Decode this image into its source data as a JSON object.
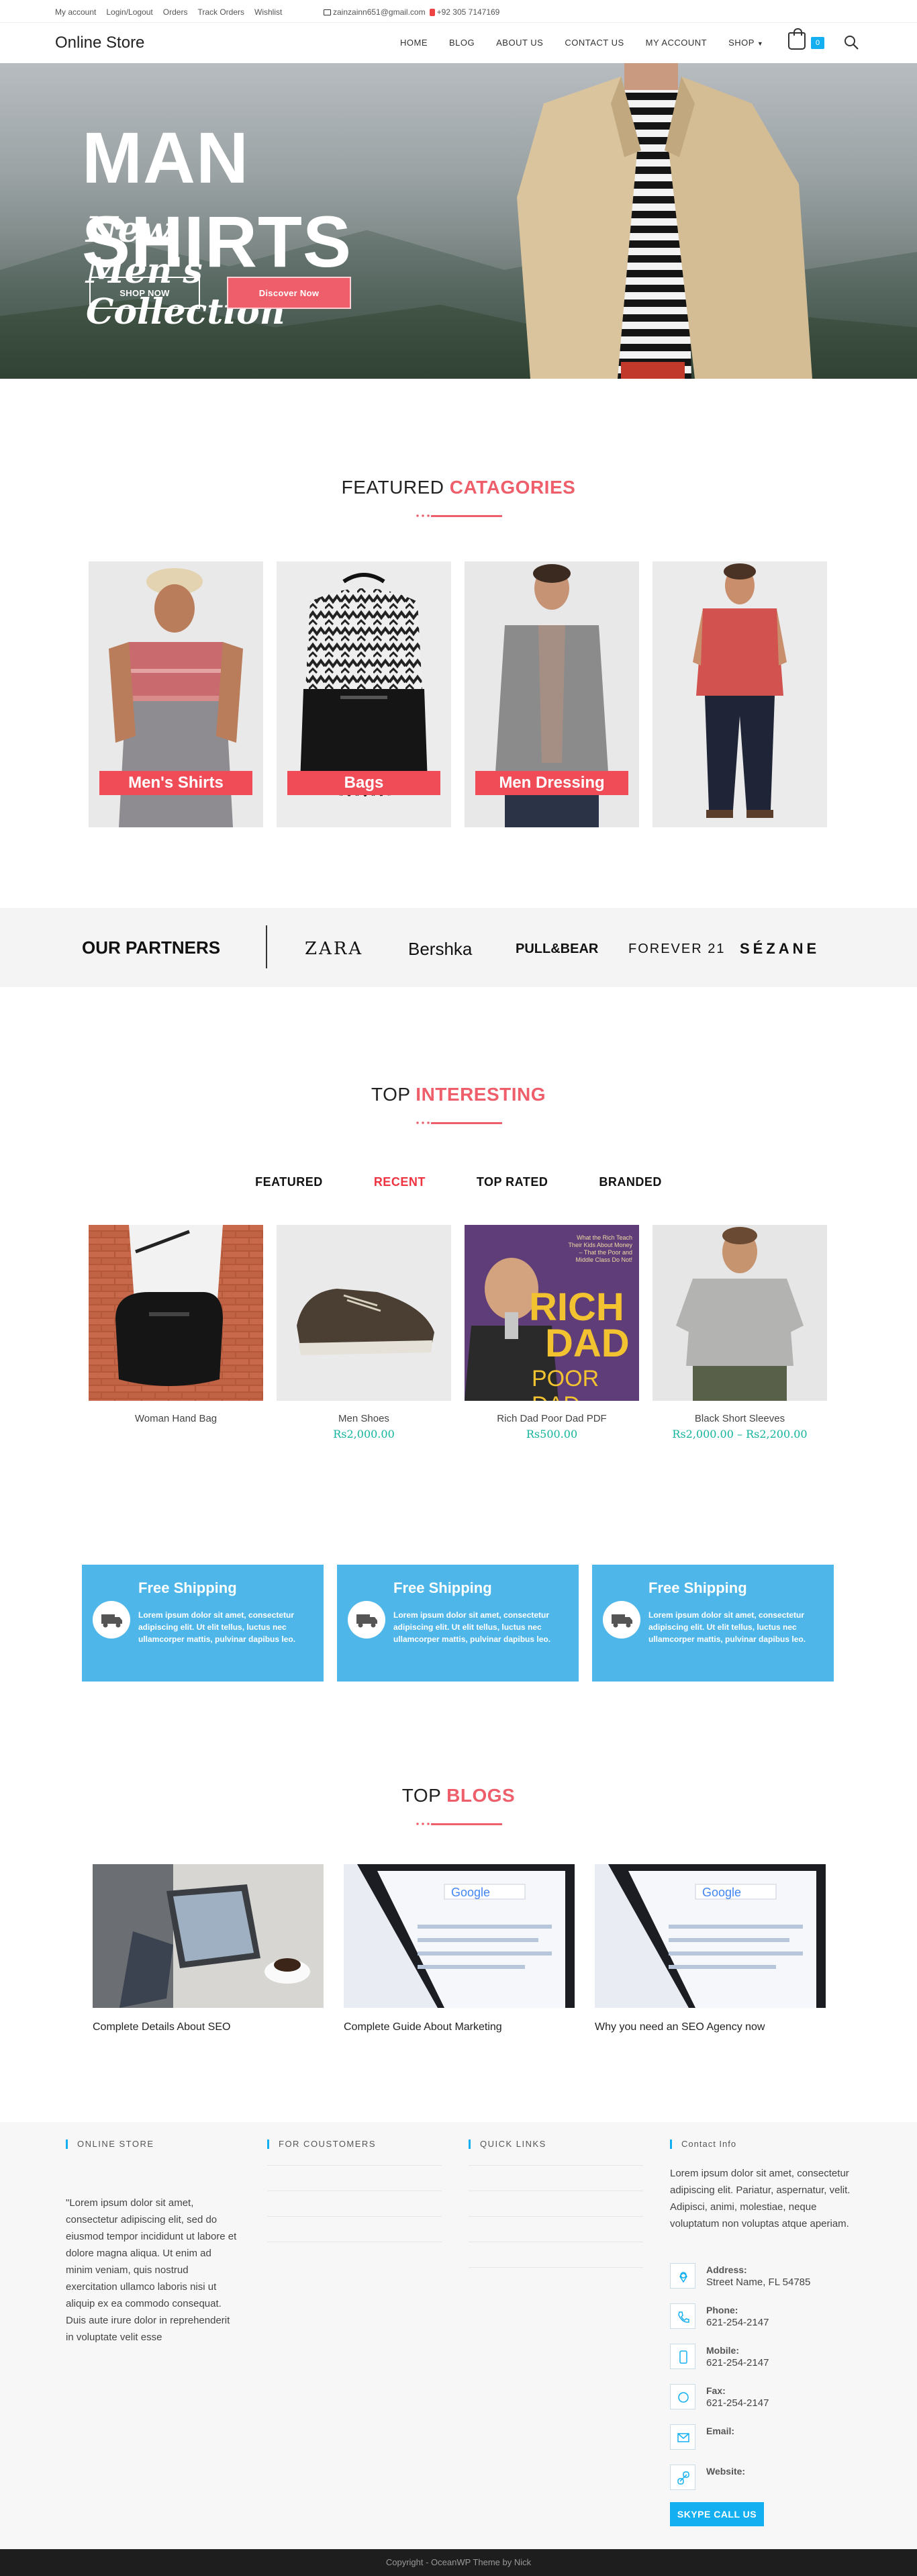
{
  "topbar": {
    "links": [
      "My account",
      "Login/Logout",
      "Orders",
      "Track Orders",
      "Wishlist"
    ],
    "email": "zainzainn651@gmail.com",
    "phone": "+92 305 7147169"
  },
  "header": {
    "logo": "Online Store",
    "nav": [
      "HOME",
      "BLOG",
      "ABOUT US",
      "CONTACT US",
      "MY ACCOUNT",
      "SHOP"
    ],
    "cart_count": "0"
  },
  "hero": {
    "title": "MAN SHIRTS",
    "subtitle": "New Men's Collection",
    "btn_primary": "SHOP NOW",
    "btn_secondary": "Discover Now"
  },
  "featured": {
    "title_plain": "FEATURED",
    "title_accent": "CATAGORIES",
    "cards": [
      "Men's Shirts",
      "Bags",
      "Men Dressing"
    ]
  },
  "partners": {
    "title": "OUR PARTNERS",
    "brands": [
      "ZARA",
      "Bershka",
      "PULL&BEAR",
      "FOREVER 21",
      "SÉZANE"
    ]
  },
  "interesting": {
    "title_plain": "TOP",
    "title_accent": "INTERESTING",
    "tabs": [
      "FEATURED",
      "RECENT",
      "TOP RATED",
      "BRANDED"
    ],
    "active_tab": "RECENT",
    "products": [
      {
        "name": "Woman Hand Bag",
        "price": ""
      },
      {
        "name": "Men Shoes",
        "price": "Rs2,000.00"
      },
      {
        "name": "Rich Dad Poor Dad PDF",
        "price": "Rs500.00"
      },
      {
        "name": "Black Short Sleeves",
        "price": "Rs2,000.00 – Rs2,200.00"
      }
    ],
    "book_cover": {
      "tagline": "What the Rich Teach Their Kids About Money – That the Poor and Middle Class Do Not!",
      "line1": "RICH",
      "line2": "DAD",
      "line3": "POOR DAD"
    }
  },
  "features": [
    {
      "title": "Free Shipping",
      "text": "Lorem ipsum dolor sit amet, consectetur adipiscing elit. Ut elit tellus, luctus nec ullamcorper mattis, pulvinar dapibus leo."
    },
    {
      "title": "Free Shipping",
      "text": "Lorem ipsum dolor sit amet, consectetur adipiscing elit. Ut elit tellus, luctus nec ullamcorper mattis, pulvinar dapibus leo."
    },
    {
      "title": "Free Shipping",
      "text": "Lorem ipsum dolor sit amet, consectetur adipiscing elit. Ut elit tellus, luctus nec ullamcorper mattis, pulvinar dapibus leo."
    }
  ],
  "blogs": {
    "title_plain": "TOP",
    "title_accent": "BLOGS",
    "posts": [
      "Complete Details About SEO",
      "Complete Guide About Marketing",
      "Why you need an SEO Agency now"
    ]
  },
  "footer": {
    "col1_head": "ONLINE STORE",
    "col1_text": "\"Lorem ipsum dolor sit amet, consectetur adipiscing elit, sed do eiusmod tempor incididunt ut labore et dolore magna aliqua. Ut enim ad minim veniam, quis nostrud exercitation ullamco laboris nisi ut aliquip ex ea commodo consequat. Duis aute irure dolor in reprehenderit in voluptate velit esse",
    "col2_head": "FOR COUSTOMERS",
    "col3_head": "QUICK LINKS",
    "col4_head": "Contact Info",
    "col4_text": "Lorem ipsum dolor sit amet, consectetur adipiscing elit. Pariatur, aspernatur, velit. Adipisci, animi, molestiae, neque voluptatum non voluptas atque aperiam.",
    "contact": [
      {
        "label": "Address:",
        "value": "Street Name, FL 54785",
        "icon": "map-pin-icon"
      },
      {
        "label": "Phone:",
        "value": "621-254-2147",
        "icon": "phone-icon"
      },
      {
        "label": "Mobile:",
        "value": "621-254-2147",
        "icon": "mobile-icon"
      },
      {
        "label": "Fax:",
        "value": "621-254-2147",
        "icon": "fax-icon"
      },
      {
        "label": "Email:",
        "value": "",
        "icon": "mail-icon"
      },
      {
        "label": "Website:",
        "value": "",
        "icon": "link-icon"
      }
    ],
    "skype_btn": "SKYPE CALL US",
    "copyright": "Copyright - OceanWP Theme by Nick"
  },
  "colors": {
    "accent": "#ef5f6b",
    "blue": "#4eb6e8",
    "price": "#13b49c",
    "link_blue": "#13aff0"
  }
}
